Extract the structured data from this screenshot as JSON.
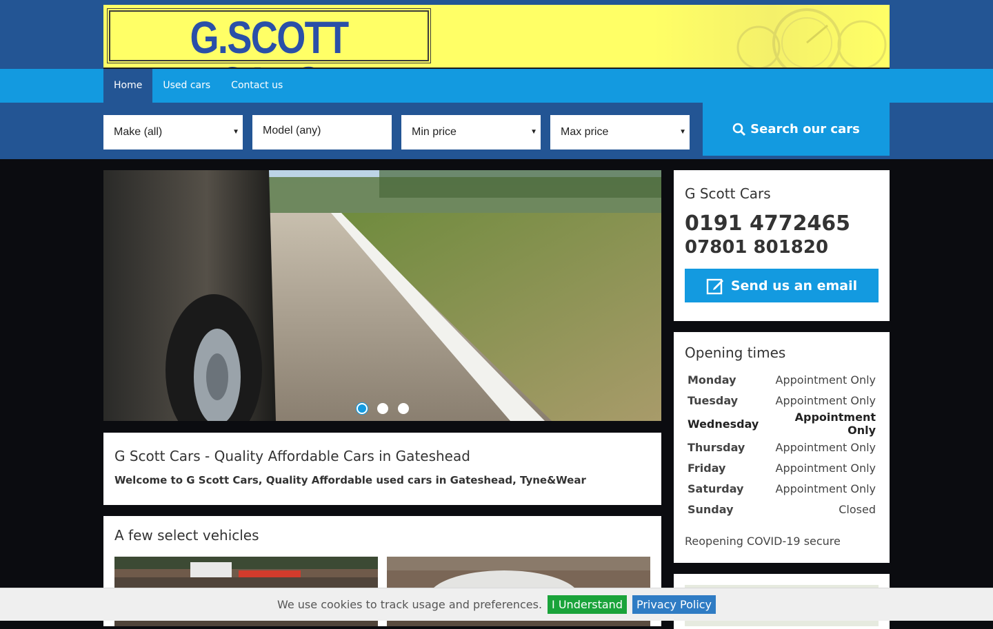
{
  "brand": {
    "logo_text": "G.SCOTT CARS"
  },
  "nav": {
    "items": [
      "Home",
      "Used cars",
      "Contact us"
    ]
  },
  "search": {
    "make": "Make (all)",
    "model": "Model (any)",
    "min_price": "Min price",
    "max_price": "Max price",
    "button": "Search our cars"
  },
  "welcome": {
    "title": "G Scott Cars - Quality Affordable Cars  in Gateshead",
    "text": "Welcome to G Scott Cars, Quality Affordable used cars in Gateshead, Tyne&Wear"
  },
  "vehicles": {
    "title": "A few select vehicles"
  },
  "contact": {
    "name": "G Scott Cars",
    "phone1": "0191 4772465",
    "phone2": "07801 801820",
    "email_button": "Send us an email"
  },
  "hours": {
    "title": "Opening times",
    "rows": [
      {
        "day": "Monday",
        "value": "Appointment Only"
      },
      {
        "day": "Tuesday",
        "value": "Appointment Only"
      },
      {
        "day": "Wednesday",
        "value": "Appointment Only"
      },
      {
        "day": "Thursday",
        "value": "Appointment Only"
      },
      {
        "day": "Friday",
        "value": "Appointment Only"
      },
      {
        "day": "Saturday",
        "value": "Appointment Only"
      },
      {
        "day": "Sunday",
        "value": "Closed"
      }
    ],
    "note": "Reopening COVID-19 secure"
  },
  "cookie": {
    "text": "We use cookies to track usage and preferences.",
    "accept": "I Understand",
    "policy": "Privacy Policy"
  },
  "colors": {
    "accent": "#139ae0",
    "navy": "#235594",
    "banner": "#ffff66"
  }
}
